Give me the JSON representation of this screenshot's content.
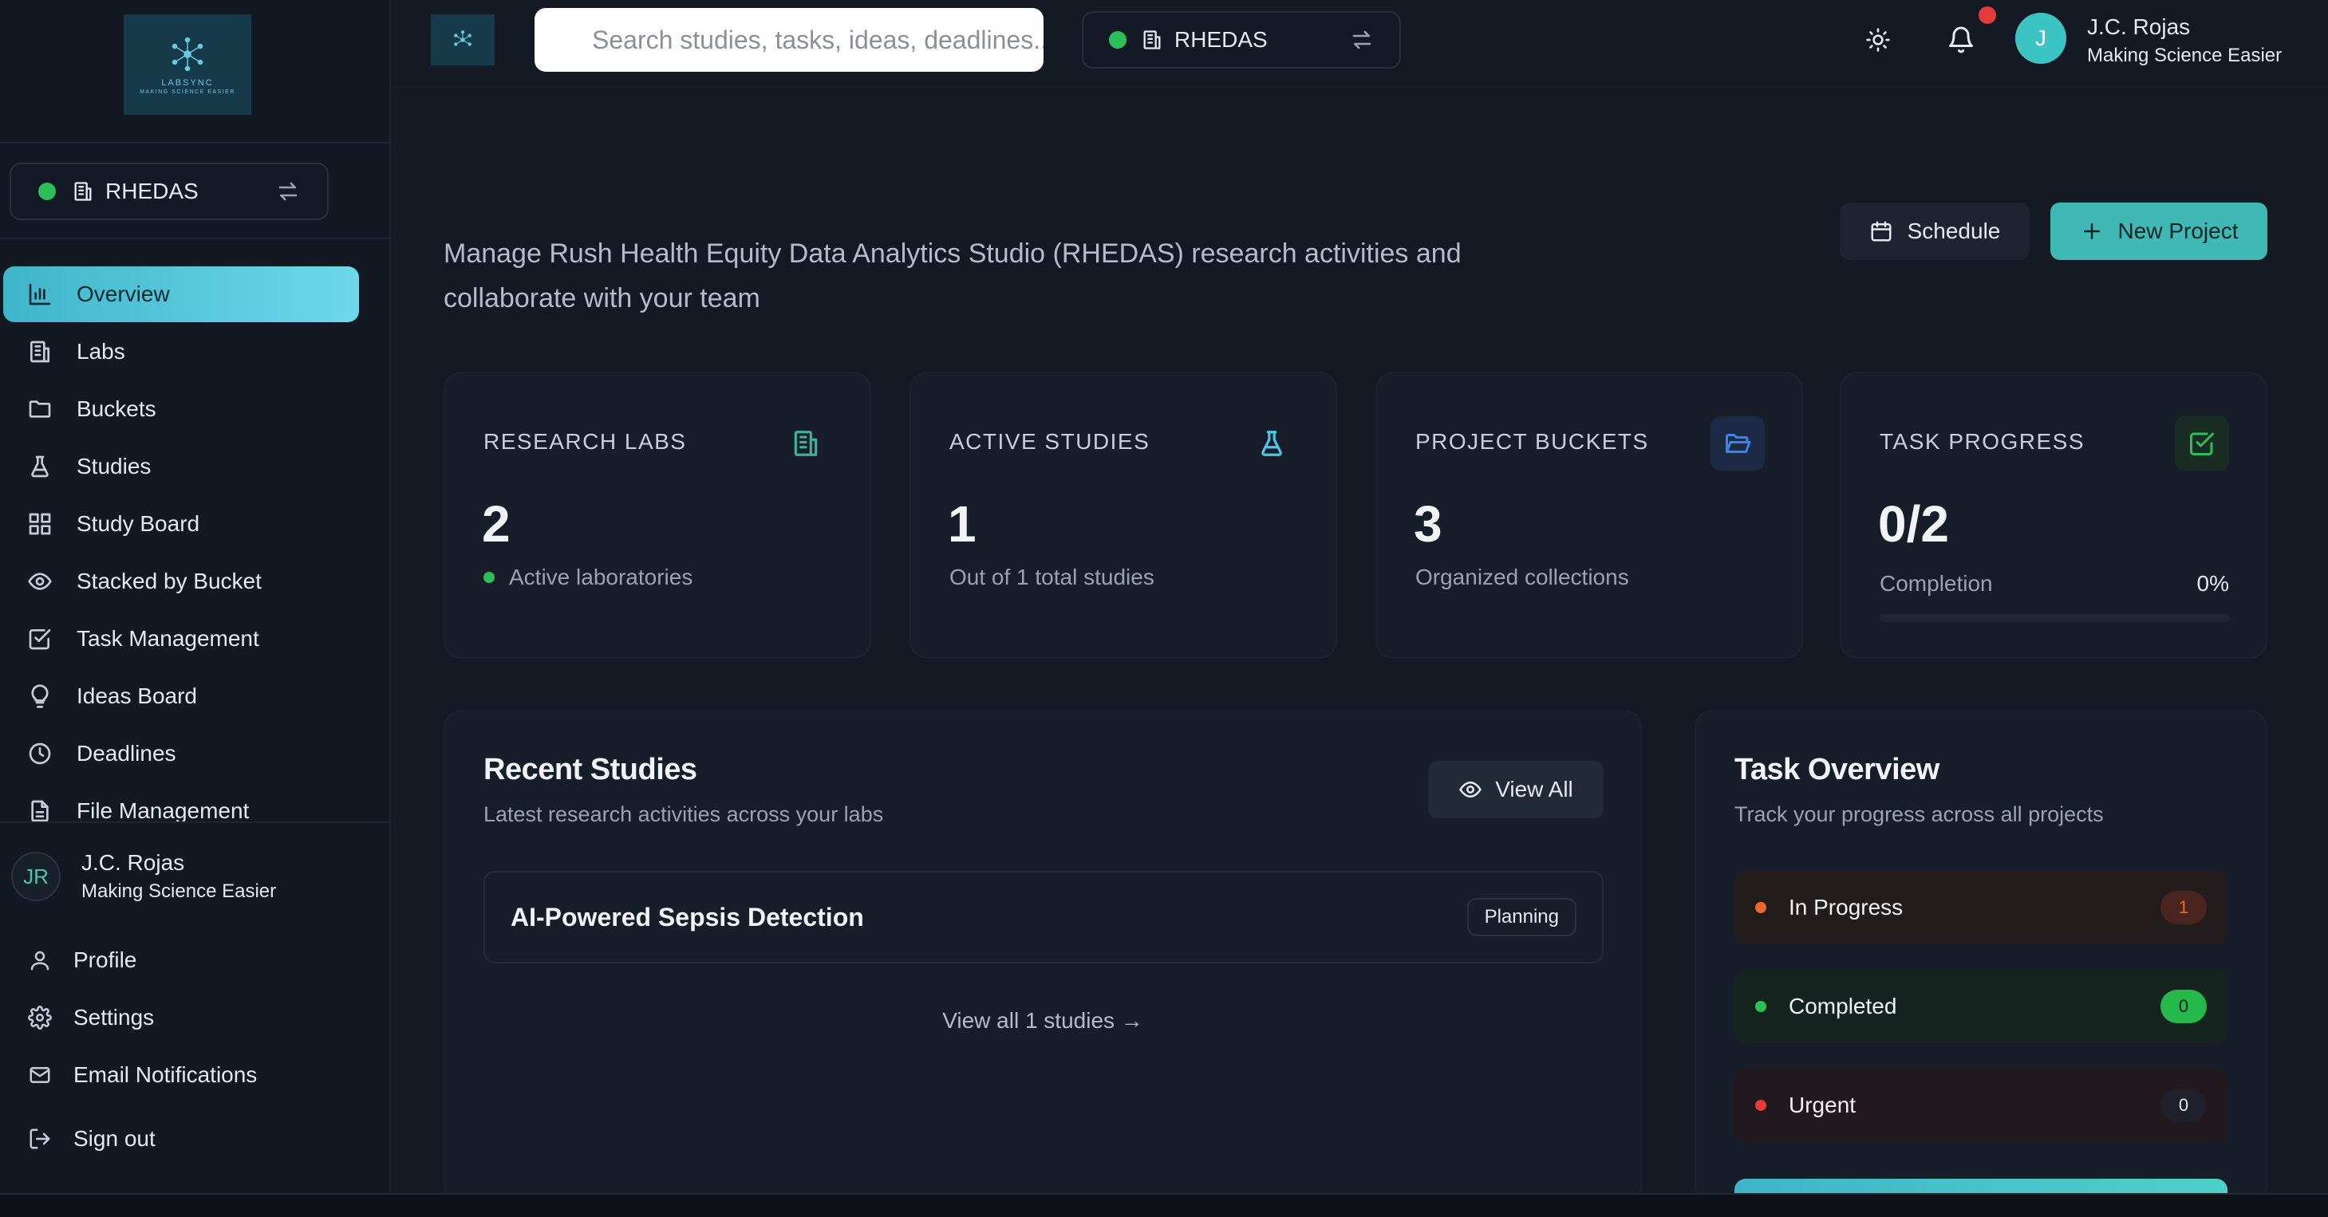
{
  "colors": {
    "accent": "#40b8b3",
    "status_active": "#2dbe5a",
    "notification": "#e53b3b"
  },
  "logo": {
    "brand": "LABSYNC",
    "tagline": "MAKING SCIENCE EASIER"
  },
  "sidebar": {
    "lab": {
      "name": "RHEDAS"
    },
    "nav": [
      {
        "label": "Overview",
        "icon": "bar-chart-icon"
      },
      {
        "label": "Labs",
        "icon": "building-icon"
      },
      {
        "label": "Buckets",
        "icon": "folder-icon"
      },
      {
        "label": "Studies",
        "icon": "flask-icon"
      },
      {
        "label": "Study Board",
        "icon": "grid-icon"
      },
      {
        "label": "Stacked by Bucket",
        "icon": "eye-icon"
      },
      {
        "label": "Task Management",
        "icon": "checkbox-icon"
      },
      {
        "label": "Ideas Board",
        "icon": "lightbulb-icon"
      },
      {
        "label": "Deadlines",
        "icon": "clock-icon"
      },
      {
        "label": "File Management",
        "icon": "file-icon"
      }
    ],
    "user": {
      "initials": "JR",
      "name": "J.C. Rojas",
      "subtitle": "Making Science Easier"
    },
    "account": [
      {
        "label": "Profile",
        "icon": "user-icon"
      },
      {
        "label": "Settings",
        "icon": "gear-icon"
      },
      {
        "label": "Email Notifications",
        "icon": "mail-icon"
      },
      {
        "label": "Sign out",
        "icon": "logout-icon"
      }
    ]
  },
  "topbar": {
    "search_placeholder": "Search studies, tasks, ideas, deadlines...",
    "lab": {
      "name": "RHEDAS"
    },
    "user": {
      "initial": "J",
      "name": "J.C. Rojas",
      "subtitle": "Making Science Easier"
    }
  },
  "main": {
    "intro": "Manage Rush Health Equity Data Analytics Studio (RHEDAS) research activities and collaborate with your team",
    "buttons": {
      "schedule": "Schedule",
      "new_project": "New Project"
    },
    "stats": [
      {
        "label": "RESEARCH LABS",
        "value": "2",
        "desc": "Active laboratories",
        "icon": "building-icon"
      },
      {
        "label": "ACTIVE STUDIES",
        "value": "1",
        "desc": "Out of 1 total studies",
        "icon": "flask-icon"
      },
      {
        "label": "PROJECT BUCKETS",
        "value": "3",
        "desc": "Organized collections",
        "icon": "folder-open-icon"
      },
      {
        "label": "TASK PROGRESS",
        "value": "0/2",
        "desc": "Completion",
        "percent": "0%",
        "progress": 0,
        "icon": "check-square-icon"
      }
    ],
    "recent_studies": {
      "title": "Recent Studies",
      "subtitle": "Latest research activities across your labs",
      "view_all_button": "View All",
      "items": [
        {
          "name": "AI-Powered Sepsis Detection",
          "status": "Planning"
        }
      ],
      "view_all_link": "View all 1 studies →"
    },
    "task_overview": {
      "title": "Task Overview",
      "subtitle": "Track your progress across all projects",
      "rows": [
        {
          "label": "In Progress",
          "count": "1",
          "dot": "#f0692b",
          "bg": "#231c1d",
          "badge_bg": "#4a2520",
          "badge_fg": "#f0692b"
        },
        {
          "label": "Completed",
          "count": "0",
          "dot": "#2dbe5a",
          "bg": "#16241f",
          "badge_bg": "#25b84a",
          "badge_fg": "#0b1f12"
        },
        {
          "label": "Urgent",
          "count": "0",
          "dot": "#e53b3b",
          "bg": "#22191f",
          "badge_bg": "#1f2029",
          "badge_fg": "#e6e9ef"
        }
      ]
    }
  }
}
